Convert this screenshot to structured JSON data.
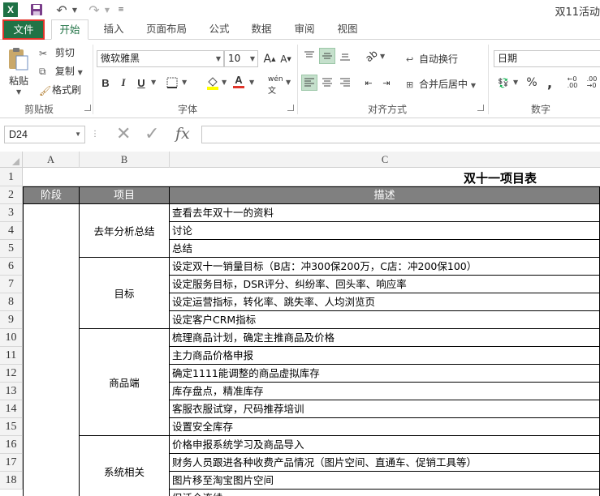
{
  "window": {
    "title": "双11活动"
  },
  "ribbon_tabs": [
    "文件",
    "开始",
    "插入",
    "页面布局",
    "公式",
    "数据",
    "审阅",
    "视图"
  ],
  "clipboard": {
    "paste": "粘贴",
    "cut": "剪切",
    "copy": "复制",
    "format_painter": "格式刷",
    "group": "剪贴板"
  },
  "font": {
    "name": "微软雅黑",
    "size": "10",
    "group": "字体",
    "bold": "B",
    "italic": "I",
    "underline": "U",
    "font_color_letter": "A",
    "phonetic": "wén"
  },
  "alignment": {
    "wrap_text": "自动换行",
    "merge_center": "合并后居中",
    "group": "对齐方式"
  },
  "number": {
    "format": "日期",
    "group": "数字",
    "percent": "%"
  },
  "formula_bar": {
    "name_box": "D24",
    "fx": "fx"
  },
  "columns": [
    "A",
    "B",
    "C"
  ],
  "rows": [
    "1",
    "2",
    "3",
    "4",
    "5",
    "6",
    "7",
    "8",
    "9",
    "10",
    "11",
    "12",
    "13",
    "14",
    "15",
    "16",
    "17",
    "18"
  ],
  "sheet": {
    "title": "双十一项目表",
    "headers": {
      "stage": "阶段",
      "item": "项目",
      "desc": "描述"
    },
    "groups": [
      {
        "item": "去年分析总结",
        "rows": [
          "查看去年双十一的资料",
          "讨论",
          "总结"
        ]
      },
      {
        "item": "目标",
        "rows": [
          "设定双十一销量目标（B店：冲300保200万，C店：冲200保100）",
          "设定服务目标，DSR评分、纠纷率、回头率、响应率",
          "设定运营指标，转化率、跳失率、人均浏览页",
          "设定客户CRM指标"
        ]
      },
      {
        "item": "商品端",
        "rows": [
          "梳理商品计划，确定主推商品及价格",
          "主力商品价格申报",
          "确定1111能调整的商品虚拟库存",
          "库存盘点，精准库存",
          "客服衣服试穿，尺码推荐培训",
          "设置安全库存"
        ]
      },
      {
        "item": "系统相关",
        "rows": [
          "价格申报系统学习及商品导入",
          "财务人员跟进各种收费产品情况（图片空间、直通车、促销工具等）",
          "图片移至淘宝图片空间",
          "促活全连续"
        ]
      }
    ]
  },
  "colors": {
    "file_tab": "#217346",
    "file_tab_border": "#e0352a",
    "header_fill": "#808080"
  }
}
